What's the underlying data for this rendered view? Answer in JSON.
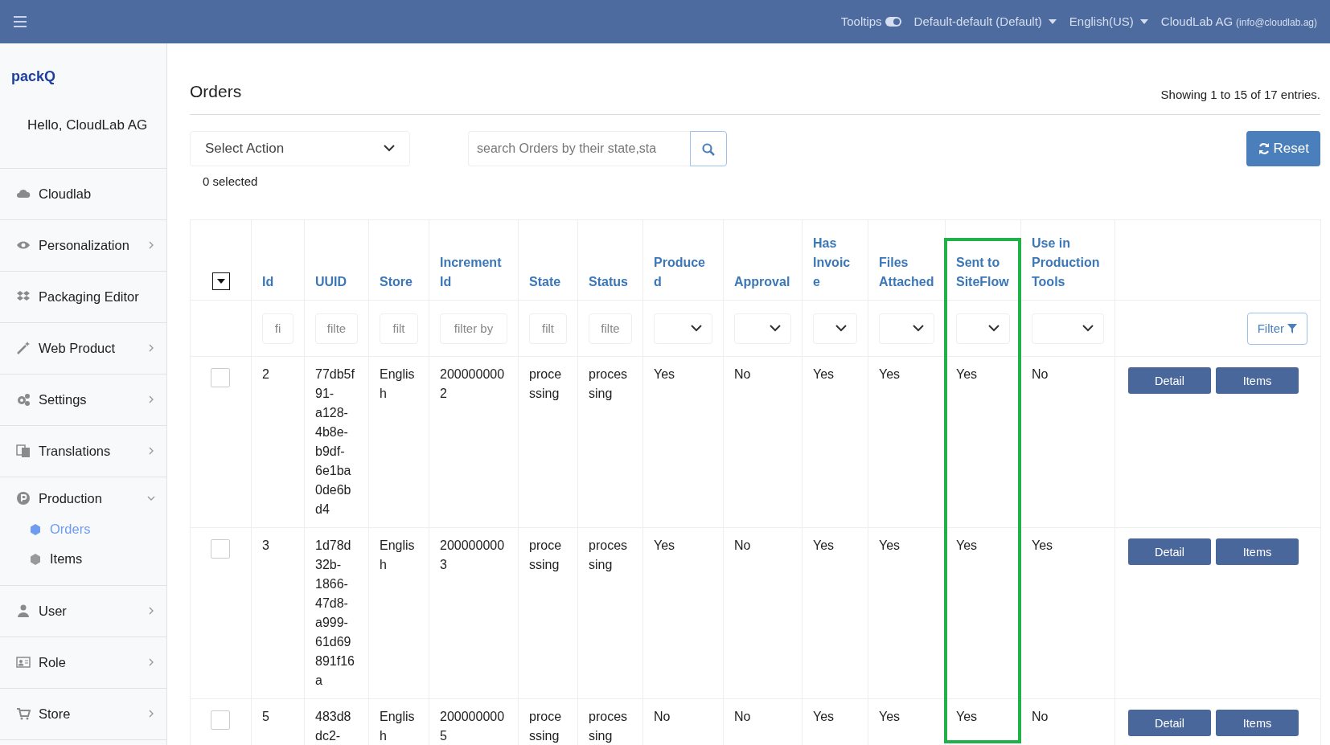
{
  "topbar": {
    "tooltips": {
      "label": "Tooltips",
      "on": true
    },
    "theme": "Default-default (Default)",
    "language": "English(US)",
    "user": "CloudLab AG",
    "email": "(info@cloudlab.ag)"
  },
  "sidebar": {
    "logo": "packQ",
    "greeting": "Hello, CloudLab AG",
    "items": [
      {
        "label": "Cloudlab",
        "kind": "cloud",
        "submenu": false,
        "expanded": false
      },
      {
        "label": "Personalization",
        "kind": "eye",
        "submenu": true,
        "expanded": false
      },
      {
        "label": "Packaging Editor",
        "kind": "boxes",
        "submenu": false,
        "expanded": false
      },
      {
        "label": "Web Product",
        "kind": "wand",
        "submenu": true,
        "expanded": false
      },
      {
        "label": "Settings",
        "kind": "gears",
        "submenu": true,
        "expanded": false
      },
      {
        "label": "Translations",
        "kind": "translate",
        "submenu": true,
        "expanded": false
      },
      {
        "label": "Production",
        "kind": "p-circle",
        "submenu": true,
        "expanded": true,
        "children": [
          {
            "label": "Orders",
            "selected": true
          },
          {
            "label": "Items",
            "selected": false
          }
        ]
      },
      {
        "label": "User",
        "kind": "user",
        "submenu": true,
        "expanded": false
      },
      {
        "label": "Role",
        "kind": "id-card",
        "submenu": true,
        "expanded": false
      },
      {
        "label": "Store",
        "kind": "cart",
        "submenu": true,
        "expanded": false
      }
    ]
  },
  "page": {
    "title": "Orders",
    "summary": "Showing 1 to 15 of 17 entries.",
    "action_select": "Select Action",
    "selected_count": "0 selected",
    "search": {
      "placeholder": "search Orders by their state,sta"
    },
    "reset_button": "Reset",
    "filter_button": "Filter"
  },
  "table": {
    "columns": [
      {
        "label": "Id",
        "kind": "text",
        "placeholder": "fi",
        "highlighted": false
      },
      {
        "label": "UUID",
        "kind": "text",
        "placeholder": "filte",
        "highlighted": false
      },
      {
        "label": "Store",
        "kind": "text",
        "placeholder": "filt",
        "highlighted": false
      },
      {
        "label": "Increment Id",
        "kind": "text",
        "placeholder": "filter by",
        "highlighted": false
      },
      {
        "label": "State",
        "kind": "text",
        "placeholder": "filt",
        "highlighted": false
      },
      {
        "label": "Status",
        "kind": "text",
        "placeholder": "filte",
        "highlighted": false
      },
      {
        "label": "Produced",
        "kind": "select",
        "highlighted": false
      },
      {
        "label": "Approval",
        "kind": "select",
        "highlighted": false
      },
      {
        "label": "Has Invoice",
        "kind": "select",
        "highlighted": false
      },
      {
        "label": "Files Attached",
        "kind": "select",
        "highlighted": false
      },
      {
        "label": "Sent to SiteFlow",
        "kind": "select",
        "highlighted": true
      },
      {
        "label": "Use in Production Tools",
        "kind": "select",
        "highlighted": false
      }
    ],
    "rows": [
      {
        "checked": false,
        "cells": [
          "2",
          "77db5f91-a128-4b8e-b9df-6e1ba0de6bd4",
          "English",
          "2000000002",
          "processing",
          "processing",
          "Yes",
          "No",
          "Yes",
          "Yes",
          "Yes",
          "No"
        ],
        "actions": [
          "Detail",
          "Items"
        ]
      },
      {
        "checked": false,
        "cells": [
          "3",
          "1d78d32b-1866-47d8-a999-61d69891f16a",
          "English",
          "2000000003",
          "processing",
          "processing",
          "Yes",
          "No",
          "Yes",
          "Yes",
          "Yes",
          "Yes"
        ],
        "actions": [
          "Detail",
          "Items"
        ]
      },
      {
        "checked": false,
        "cells": [
          "5",
          "483d8dc2-",
          "English",
          "2000000005",
          "processing",
          "processing",
          "No",
          "No",
          "Yes",
          "Yes",
          "Yes",
          "No"
        ],
        "actions": [
          "Detail",
          "Items"
        ]
      }
    ]
  }
}
